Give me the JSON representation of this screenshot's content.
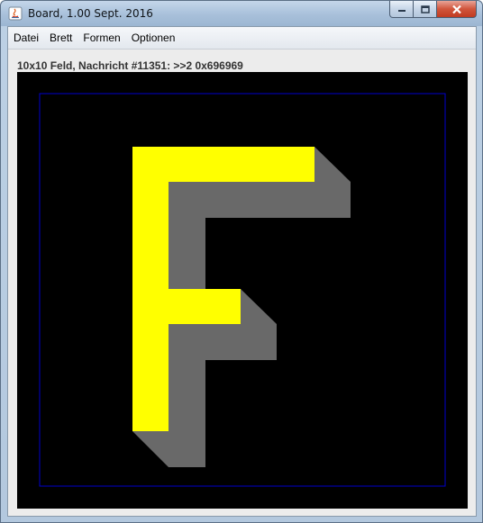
{
  "window": {
    "title": "Board, 1.00 Sept. 2016",
    "app_icon": "java-icon",
    "controls": [
      "minimize-icon",
      "maximize-icon",
      "close-icon"
    ]
  },
  "menu": {
    "items": [
      {
        "label": "Datei"
      },
      {
        "label": "Brett"
      },
      {
        "label": "Formen"
      },
      {
        "label": "Optionen"
      }
    ]
  },
  "status": {
    "text": "10x10 Feld, Nachricht #11351: >>2 0x696969"
  },
  "board": {
    "background_color": "#000000",
    "border_color": "#0000cc",
    "letter": "F",
    "letter_color": "#ffff00",
    "shadow_color": "#696969"
  }
}
